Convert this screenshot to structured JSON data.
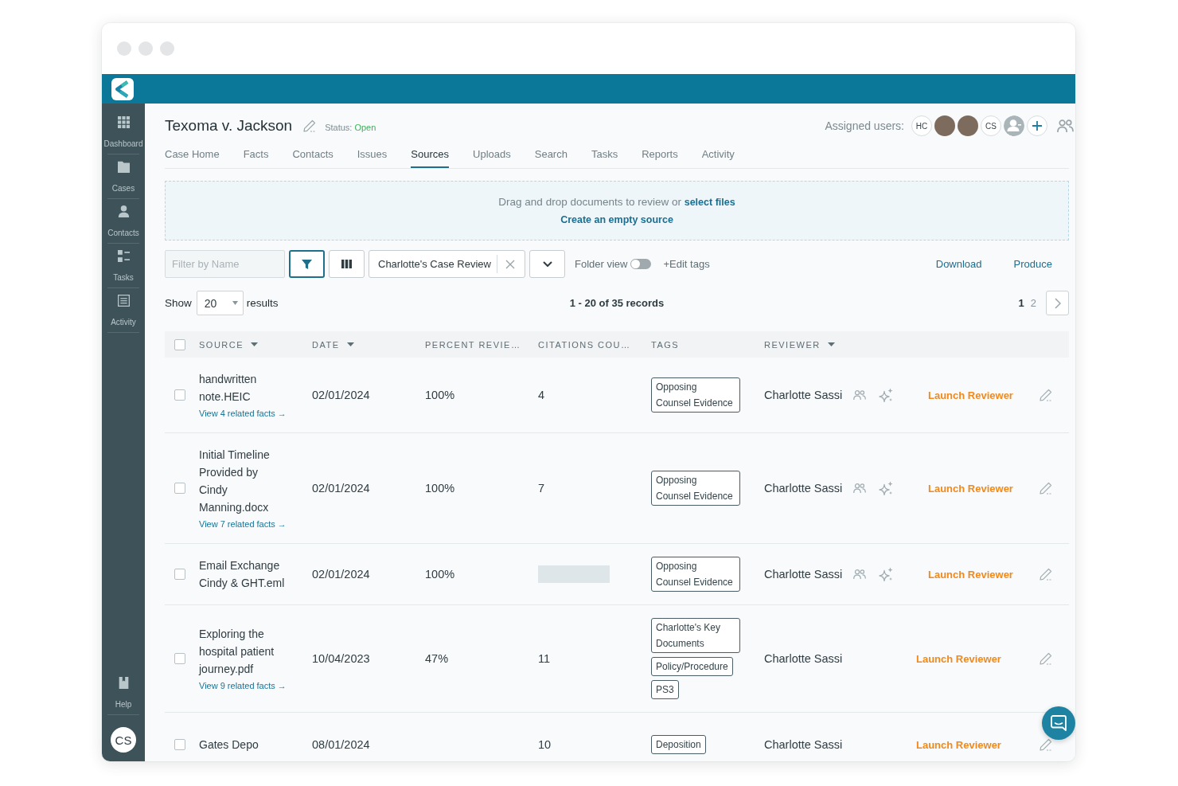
{
  "sidebar": {
    "items": [
      {
        "kind": "dashboard",
        "label": "Dashboard"
      },
      {
        "kind": "cases",
        "label": "Cases"
      },
      {
        "kind": "contacts",
        "label": "Contacts"
      },
      {
        "kind": "tasks",
        "label": "Tasks"
      },
      {
        "kind": "activity",
        "label": "Activity"
      }
    ],
    "help": {
      "label": "Help"
    },
    "user": {
      "initials": "CS"
    }
  },
  "case": {
    "title": "Texoma v. Jackson",
    "status_label": "Status:",
    "status": "Open"
  },
  "assigned_users": {
    "label": "Assigned users:",
    "users": [
      {
        "kind": "initials",
        "initials": "HC"
      },
      {
        "kind": "photo"
      },
      {
        "kind": "photo"
      },
      {
        "kind": "initials",
        "initials": "CS"
      },
      {
        "kind": "placeholder"
      }
    ]
  },
  "tabs": [
    {
      "label": "Case Home",
      "selected": false
    },
    {
      "label": "Facts",
      "selected": false
    },
    {
      "label": "Contacts",
      "selected": false
    },
    {
      "label": "Issues",
      "selected": false
    },
    {
      "label": "Sources",
      "selected": true
    },
    {
      "label": "Uploads",
      "selected": false
    },
    {
      "label": "Search",
      "selected": false
    },
    {
      "label": "Tasks",
      "selected": false
    },
    {
      "label": "Reports",
      "selected": false
    },
    {
      "label": "Activity",
      "selected": false
    }
  ],
  "dropzone": {
    "text": "Drag and drop documents to review or",
    "link": "select files",
    "create_link": "Create an empty source"
  },
  "toolbar": {
    "filter_placeholder": "Filter by Name",
    "filter_active": true,
    "view": "Charlotte's Case Review",
    "folder_view": {
      "label": "Folder view",
      "on": false
    },
    "edit_tags": "+Edit tags",
    "actions": [
      "Download",
      "Produce"
    ]
  },
  "paging": {
    "show_label": "Show",
    "page_size": "20",
    "results_label": "results",
    "summary": "1 - 20 of 35 records",
    "pages": [
      {
        "label": "1",
        "selected": true
      },
      {
        "label": "2",
        "selected": false
      }
    ]
  },
  "table": {
    "select_all": {
      "checked": false
    },
    "columns": [
      {
        "label": "SOURCE",
        "sortable": true
      },
      {
        "label": "DATE",
        "sortable": true
      },
      {
        "label": "PERCENT REVIE…",
        "sortable": false
      },
      {
        "label": "CITATIONS COU…",
        "sortable": false
      },
      {
        "label": "TAGS",
        "sortable": false
      },
      {
        "label": "REVIEWER",
        "sortable": true
      }
    ],
    "rows": [
      {
        "checked": false,
        "source": "handwritten note.HEIC",
        "facts_link": "View 4 related facts →",
        "date": "02/01/2024",
        "percent": "100%",
        "citations_loading": false,
        "citations": "4",
        "tags": [
          "Opposing Counsel Evidence"
        ],
        "reviewer": "Charlotte Sassi",
        "reviewer_tools": true,
        "action": "Launch Reviewer"
      },
      {
        "checked": false,
        "source": "Initial Timeline Provided by Cindy Manning.docx",
        "facts_link": "View 7 related facts →",
        "date": "02/01/2024",
        "percent": "100%",
        "citations_loading": false,
        "citations": "7",
        "tags": [
          "Opposing Counsel Evidence"
        ],
        "reviewer": "Charlotte Sassi",
        "reviewer_tools": true,
        "action": "Launch Reviewer"
      },
      {
        "checked": false,
        "source": "Email Exchange Cindy & GHT.eml",
        "date": "02/01/2024",
        "percent": "100%",
        "citations_loading": true,
        "tags": [
          "Opposing Counsel Evidence"
        ],
        "reviewer": "Charlotte Sassi",
        "reviewer_tools": true,
        "action": "Launch Reviewer"
      },
      {
        "checked": false,
        "source": "Exploring the hospital patient journey.pdf",
        "facts_link": "View 9 related facts →",
        "date": "10/04/2023",
        "percent": "47%",
        "citations_loading": false,
        "citations": "11",
        "tags": [
          "Charlotte's Key Documents",
          "Policy/Procedure",
          "PS3"
        ],
        "reviewer": "Charlotte Sassi",
        "reviewer_tools": false,
        "action": "Launch Reviewer"
      },
      {
        "checked": false,
        "source": "Gates Depo",
        "date": "08/01/2024",
        "citations_loading": false,
        "citations": "10",
        "tags": [
          "Deposition"
        ],
        "reviewer": "Charlotte Sassi",
        "reviewer_tools": false,
        "action": "Launch Reviewer"
      }
    ]
  }
}
